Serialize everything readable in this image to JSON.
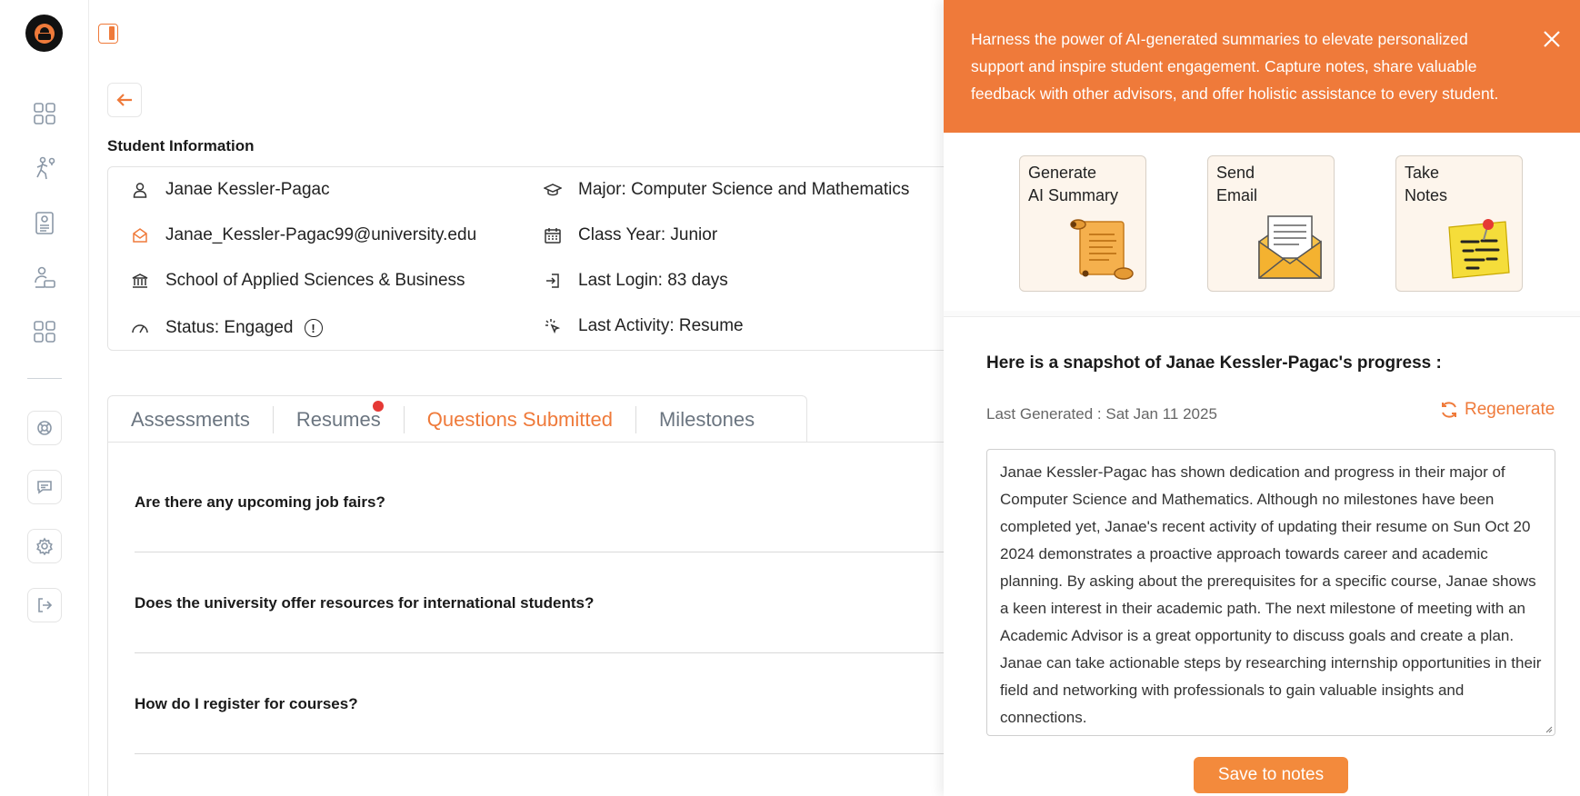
{
  "rail": {
    "items": [
      {
        "name": "dashboard",
        "icon": "grid-icon"
      },
      {
        "name": "career",
        "icon": "career-icon"
      },
      {
        "name": "profile",
        "icon": "id-card-icon"
      },
      {
        "name": "advisors",
        "icon": "users-icon"
      },
      {
        "name": "apps",
        "icon": "grid-icon"
      }
    ],
    "bottom": [
      "support-icon",
      "chat-icon",
      "gear-icon",
      "logout-icon"
    ]
  },
  "student_section": {
    "title": "Student Information",
    "name": "Janae Kessler-Pagac",
    "email": "Janae_Kessler-Pagac99@university.edu",
    "school": "School of Applied Sciences & Business",
    "status": "Status: Engaged",
    "major": "Major: Computer Science and Mathematics",
    "class_year": "Class Year: Junior",
    "last_login": "Last Login: 83 days",
    "last_activity": "Last Activity: Resume"
  },
  "tabs": [
    {
      "label": "Assessments"
    },
    {
      "label": "Resumes"
    },
    {
      "label": "Questions Submitted"
    },
    {
      "label": "Milestones"
    }
  ],
  "questions": [
    "Are there any upcoming job fairs?",
    "Does the university offer resources for international students?",
    "How do I register for courses?"
  ],
  "panel": {
    "banner": "Harness the power of AI-generated summaries to elevate personalized support and inspire student engagement. Capture notes, share valuable feedback with other advisors, and offer holistic assistance to every student.",
    "actions": [
      {
        "line1": "Generate",
        "line2": "AI Summary"
      },
      {
        "line1": "Send",
        "line2": "Email"
      },
      {
        "line1": "Take",
        "line2": "Notes"
      }
    ],
    "summary_title": "Here is a snapshot of Janae Kessler-Pagac's progress :",
    "last_generated": "Last Generated : Sat Jan 11 2025",
    "regenerate_label": "Regenerate",
    "summary_text": "Janae Kessler-Pagac has shown dedication and progress in their major of Computer Science and Mathematics. Although no milestones have been completed yet, Janae's recent activity of updating their resume on Sun Oct 20 2024 demonstrates a proactive approach towards career and academic planning. By asking about the prerequisites for a specific course, Janae shows a keen interest in their academic path. The next milestone of meeting with an Academic Advisor is a great opportunity to discuss goals and create a plan. Janae can take actionable steps by researching internship opportunities in their field and networking with professionals to gain valuable insights and connections.",
    "save_label": "Save to notes"
  },
  "colors": {
    "accent": "#ef7a3a",
    "dot": "#e53935"
  }
}
